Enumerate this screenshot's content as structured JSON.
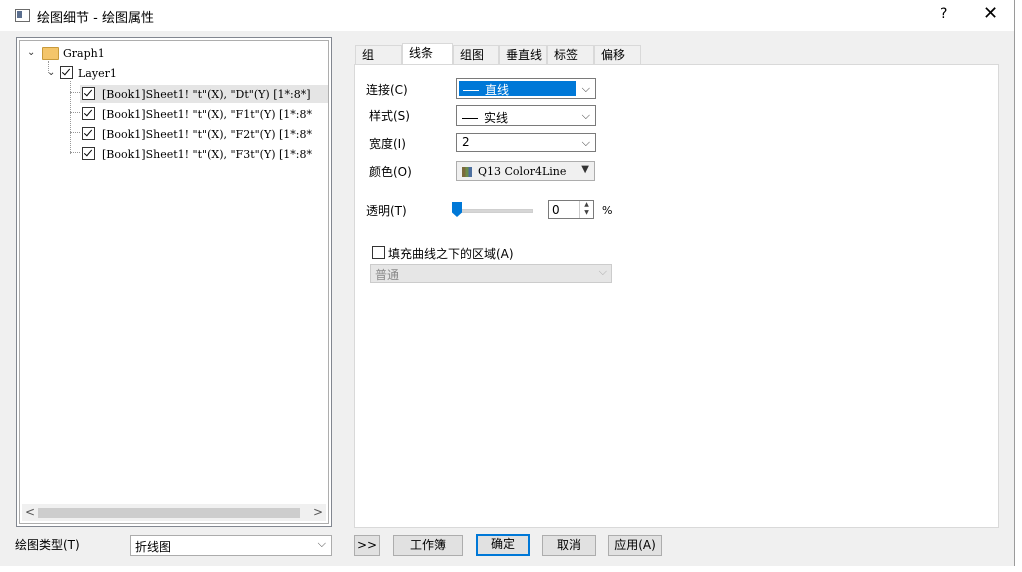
{
  "window": {
    "title": "绘图细节 - 绘图属性",
    "help_label": "?",
    "close_label": "✕"
  },
  "tree": {
    "graph": "Graph1",
    "layer": "Layer1",
    "plots": [
      "[Book1]Sheet1! \"t\"(X), \"Dt\"(Y) [1*:8*]",
      "[Book1]Sheet1! \"t\"(X), \"F1t\"(Y) [1*:8*",
      "[Book1]Sheet1! \"t\"(X), \"F2t\"(Y) [1*:8*",
      "[Book1]Sheet1! \"t\"(X), \"F3t\"(Y) [1*:8*"
    ]
  },
  "plot_type": {
    "label": "绘图类型(T)",
    "value": "折线图"
  },
  "tabs": [
    "组",
    "线条",
    "组图",
    "垂直线",
    "标签",
    "偏移"
  ],
  "active_tab": "线条",
  "line": {
    "connect_label": "连接(C)",
    "connect_value": "直线",
    "style_label": "样式(S)",
    "style_value": "实线",
    "width_label": "宽度(I)",
    "width_value": "2",
    "color_label": "颜色(O)",
    "color_value": "Q13 Color4Line",
    "transparency_label": "透明(T)",
    "transparency_value": "0",
    "transparency_unit": "%",
    "fill_label": "填充曲线之下的区域(A)",
    "fill_mode_value": "普通"
  },
  "buttons": {
    "expand": ">>",
    "workbook": "工作簿",
    "ok": "确定",
    "cancel": "取消",
    "apply": "应用(A)"
  }
}
